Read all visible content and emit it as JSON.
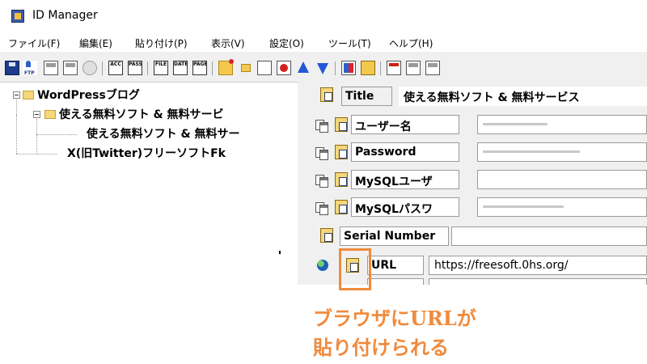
{
  "window": {
    "title": "ID Manager",
    "accent": "#3b5ca8"
  },
  "menu": [
    "ファイル(F)",
    "編集(E)",
    "貼り付け(P)",
    "表示(V)",
    "設定(O)",
    "ツール(T)",
    "ヘルプ(H)"
  ],
  "toolbar": {
    "icons": [
      "save-icon",
      "ftp-icon",
      "generate-icon",
      "generate-icon-2",
      "print-icon",
      "acc-icon",
      "pass-icon",
      "file-icon",
      "date-icon",
      "page-icon",
      "new-folder-icon",
      "move-folder-icon",
      "new-page-icon",
      "delete-icon",
      "move-up-icon",
      "move-down-icon",
      "multi-icon",
      "warning-icon",
      "note-icon",
      "list-icon"
    ],
    "texts": {
      "acc": "ACC",
      "pass": "PASS",
      "file": "FILE",
      "date": "DATE",
      "page": "PAGE"
    }
  },
  "tree": {
    "root": "WordPressブログ",
    "child": "使える無料ソフト & 無料サービ",
    "grandchild": "使える無料ソフト & 無料サー",
    "sibling": "X(旧Twitter)フリーソフトFk"
  },
  "fields": {
    "title": {
      "label": "Title",
      "value": "使える無料ソフト & 無料サービス"
    },
    "username": {
      "label": "ユーザー名",
      "value": ""
    },
    "password": {
      "label": "Password",
      "value": ""
    },
    "mysql_user": {
      "label": "MySQLユーザ",
      "value": ""
    },
    "mysql_pass": {
      "label": "MySQLパスワ",
      "value": ""
    },
    "serial": {
      "label": "Serial Number",
      "value": ""
    },
    "url": {
      "label": "URL",
      "value": "https://freesoft.0hs.org/"
    }
  },
  "annotation": {
    "line1": "ブラウザにURLが",
    "line2": "貼り付けられる",
    "color": "#f08a3c"
  }
}
